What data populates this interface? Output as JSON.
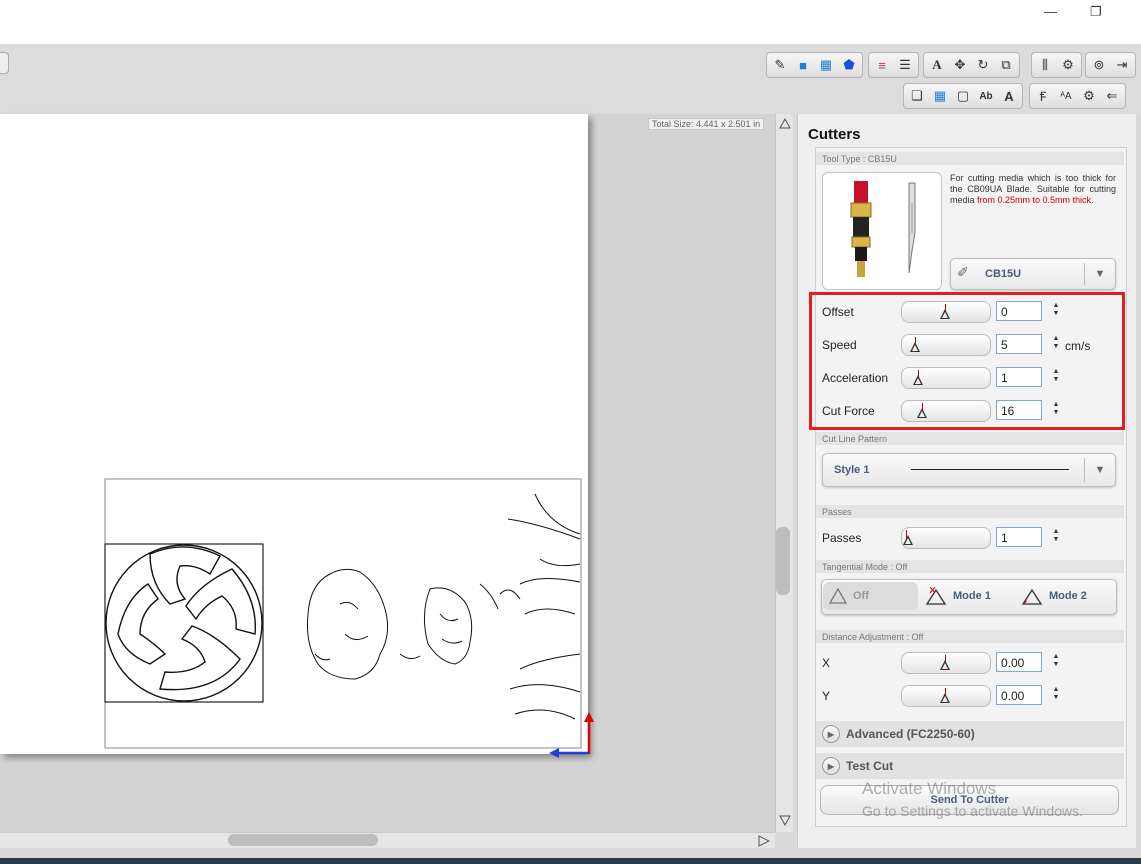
{
  "window": {
    "minimize_glyph": "—",
    "restore_glyph": "❐"
  },
  "toolbar": {
    "row1": [
      "eraser-icon",
      "fill-rect-icon",
      "pattern-fill-icon",
      "polygon-icon",
      "color-lines-icon",
      "line-style-icon",
      "text-icon",
      "node-edit-icon",
      "rotate-icon",
      "transform-icon",
      "align-icon",
      "gear-icon",
      "preview-icon",
      "import-icon"
    ],
    "row1_glyphs": [
      "✎",
      "■",
      "▦",
      "⬟",
      "≡",
      "☰",
      "A",
      "✥",
      "↻",
      "⧉",
      "⫼",
      "⚙",
      "⊚",
      "⇥"
    ],
    "row2": [
      "page-icon",
      "grid-icon",
      "fit-page-icon",
      "text-ab-icon",
      "outline-text-icon",
      "font-icon",
      "text-size-icon",
      "settings-icon",
      "send-icon"
    ],
    "row2_glyphs": [
      "❏",
      "▦",
      "▢",
      "Ab",
      "A",
      "Ꞙ",
      "ᴬA",
      "⚙",
      "⇐"
    ]
  },
  "canvas": {
    "total_size": "Total Size: 4.441 x 2.501 in"
  },
  "panel": {
    "title": "Cutters",
    "tool_type_label": "Tool Type : CB15U",
    "tool_description": "For cutting media which is too thick for the CB09UA Blade. Suitable for cutting media ",
    "tool_description_highlight": "from 0.25mm to 0.5mm thick.",
    "tool_select": "CB15U",
    "params": [
      {
        "label": "Offset",
        "value": "0",
        "unit": ""
      },
      {
        "label": "Speed",
        "value": "5",
        "unit": "cm/s"
      },
      {
        "label": "Acceleration",
        "value": "1",
        "unit": ""
      },
      {
        "label": "Cut Force",
        "value": "16",
        "unit": ""
      }
    ],
    "cut_line_pattern_label": "Cut Line Pattern",
    "cut_line_style": "Style 1",
    "passes_label": "Passes",
    "passes_param_label": "Passes",
    "passes_value": "1",
    "tangential_label": "Tangential Mode : Off",
    "tangential_modes": [
      "Off",
      "Mode 1",
      "Mode 2"
    ],
    "distance_label": "Distance Adjustment : Off",
    "distance_x_label": "X",
    "distance_x_value": "0.00",
    "distance_y_label": "Y",
    "distance_y_value": "0.00",
    "advanced_label": "Advanced (FC2250-60)",
    "test_cut_label": "Test Cut",
    "send_button": "Send To Cutter"
  },
  "watermark": {
    "line1": "Activate Windows",
    "line2": "Go to Settings to activate Windows."
  },
  "colors": {
    "highlight": "#e02020",
    "accent_text": "#4a5c7a",
    "axis_red": "#e00000",
    "axis_blue": "#1f3fd6"
  }
}
